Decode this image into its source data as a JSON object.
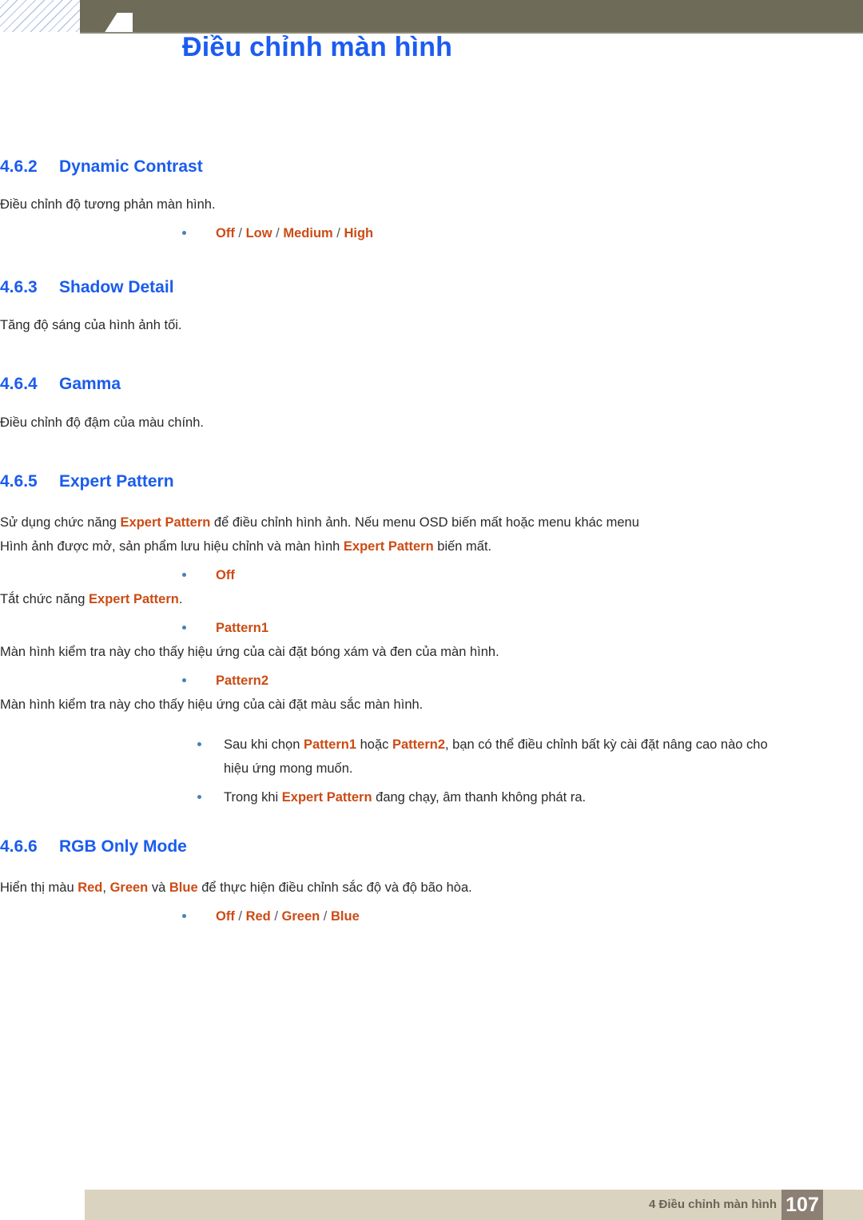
{
  "header": {
    "chapter_number": "4",
    "title": "Điều chỉnh màn hình"
  },
  "sections": [
    {
      "number": "4.6.2",
      "title": "Dynamic Contrast",
      "body": "Điều chỉnh độ tương phản màn hình.",
      "options": [
        "Off",
        "Low",
        "Medium",
        "High"
      ],
      "separator": "/"
    },
    {
      "number": "4.6.3",
      "title": "Shadow Detail",
      "body": "Tăng độ sáng của hình ảnh tối."
    },
    {
      "number": "4.6.4",
      "title": "Gamma",
      "body": "Điều chỉnh độ đậm của màu chính."
    },
    {
      "number": "4.6.5",
      "title": "Expert Pattern",
      "paragraph": {
        "part1": "Sử dụng chức năng ",
        "hl1": "Expert Pattern",
        "part2": " để điều chỉnh hình ảnh. Nếu menu OSD biến mất hoặc menu khác menu Hình ảnh được mở, sản phẩm lưu hiệu chỉnh và màn hình ",
        "hl2": "Expert Pattern",
        "part3": " biến mất."
      },
      "items": [
        {
          "label": "Off",
          "desc_part1": "Tắt chức năng ",
          "desc_hl": "Expert Pattern",
          "desc_part2": "."
        },
        {
          "label": "Pattern1",
          "desc_part1": "Màn hình kiểm tra này cho thấy hiệu ứng của cài đặt bóng xám và đen của màn hình.",
          "desc_hl": "",
          "desc_part2": ""
        },
        {
          "label": "Pattern2",
          "desc_part1": "Màn hình kiểm tra này cho thấy hiệu ứng của cài đặt màu sắc màn hình.",
          "desc_hl": "",
          "desc_part2": ""
        }
      ],
      "notes": [
        {
          "p1": "Sau khi chọn ",
          "h1": "Pattern1",
          "p2": " hoặc ",
          "h2": "Pattern2",
          "p3": ", bạn có thể điều chỉnh bất kỳ cài đặt nâng cao nào cho hiệu ứng mong muốn."
        },
        {
          "p1": "Trong khi ",
          "h1": "Expert Pattern",
          "p2": " đang chạy, âm thanh không phát ra.",
          "h2": "",
          "p3": ""
        }
      ]
    },
    {
      "number": "4.6.6",
      "title": "RGB Only Mode",
      "paragraph": {
        "part1": "Hiển thị màu ",
        "hl1": "Red",
        "part2": ", ",
        "hl2": "Green",
        "part3": " và ",
        "hl3": "Blue",
        "part4": " để thực hiện điều chỉnh sắc độ và độ bão hòa."
      },
      "options": [
        "Off",
        "Red",
        "Green",
        "Blue"
      ],
      "separator": "/"
    }
  ],
  "footer": {
    "text": "4 Điều chỉnh màn hình",
    "page_number": "107"
  },
  "colors": {
    "heading_blue": "#1a5ced",
    "highlight_orange": "#cc4b14",
    "olive_bar": "#6e6c58",
    "footer_bar": "#d9d3c0",
    "page_box": "#8c7f74"
  }
}
